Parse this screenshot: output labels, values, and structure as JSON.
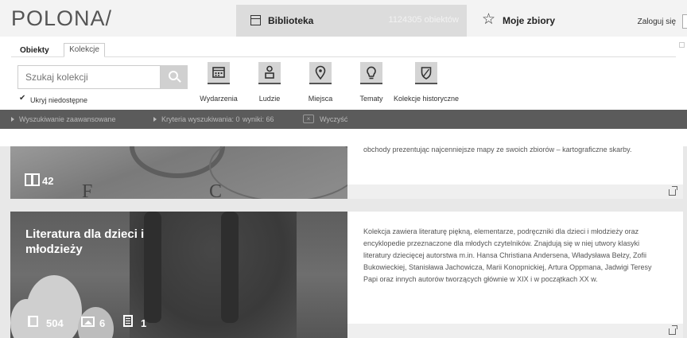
{
  "header": {
    "logo": "POLONA/",
    "library_tab": "Biblioteka",
    "object_count": "1124305 obiektów",
    "collections_tab": "Moje zbiory",
    "login": "Zaloguj się"
  },
  "search_panel": {
    "tabs": [
      "Obiekty",
      "Kolekcje"
    ],
    "active_tab": "Kolekcje",
    "search_placeholder": "Szukaj kolekcji",
    "hide_unavailable": "Ukryj niedostępne",
    "hide_unavailable_checked": true,
    "categories": [
      {
        "label": "Wydarzenia",
        "icon": "calendar-icon"
      },
      {
        "label": "Ludzie",
        "icon": "person-icon"
      },
      {
        "label": "Miejsca",
        "icon": "location-pin-icon"
      },
      {
        "label": "Tematy",
        "icon": "lightbulb-icon"
      },
      {
        "label": "Kolekcje historyczne",
        "icon": "shield-icon"
      }
    ]
  },
  "filter_bar": {
    "advanced": "Wyszukiwanie zaawansowane",
    "criteria": "Kryteria wyszukiwania: 0",
    "results": "wyniki: 66",
    "clear": "Wyczyść"
  },
  "collections": [
    {
      "title": "",
      "description": "obchody prezentując najcenniejsze mapy ze swoich zbiorów – kartograficzne skarby.",
      "counts": {
        "books": "42"
      }
    },
    {
      "title": "Literatura dla dzieci i młodzieży",
      "description": "Kolekcja zawiera literaturę piękną, elementarze, podręczniki dla dzieci i młodzieży oraz encyklopedie przeznaczone dla młodych czytelników. Znajdują się w niej utwory klasyki literatury dziecięcej autorstwa m.in. Hansa Christiana Andersena, Władysława Bełzy, Zofii Bukowieckiej, Stanisława Jachowicza, Marii Konopnickiej, Artura Oppmana, Jadwigi Teresy Papi oraz innych autorów tworzących głównie w XIX i w początkach XX w.",
      "counts": {
        "books": "504",
        "images": "6",
        "documents": "1"
      }
    }
  ]
}
